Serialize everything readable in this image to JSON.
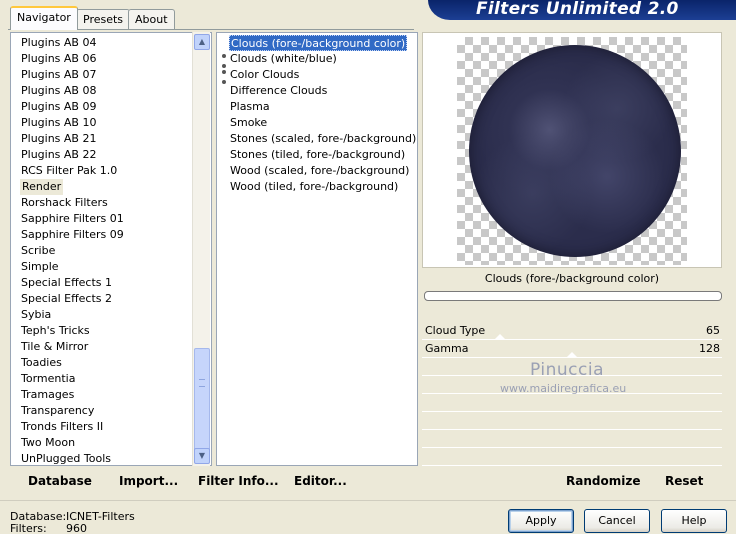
{
  "banner": {
    "title": "Filters Unlimited 2.0"
  },
  "tabs": [
    "Navigator",
    "Presets",
    "About"
  ],
  "navigator": {
    "items": [
      "Plugins AB 04",
      "Plugins AB 06",
      "Plugins AB 07",
      "Plugins AB 08",
      "Plugins AB 09",
      "Plugins AB 10",
      "Plugins AB 21",
      "Plugins AB 22",
      "RCS Filter Pak 1.0",
      "Render",
      "Rorshack Filters",
      "Sapphire Filters 01",
      "Sapphire Filters 09",
      "Scribe",
      "Simple",
      "Special Effects 1",
      "Special Effects 2",
      "Sybia",
      "Teph's Tricks",
      "Tile & Mirror",
      "Toadies",
      "Tormentia",
      "Tramages",
      "Transparency",
      "Tronds Filters II",
      "Two Moon",
      "UnPlugged Tools"
    ],
    "selected": "Render"
  },
  "filters": {
    "items": [
      "Clouds (fore-/background color)",
      "Clouds (white/blue)",
      "Color Clouds",
      "Difference Clouds",
      "Plasma",
      "Smoke",
      "Stones (scaled, fore-/background)",
      "Stones (tiled, fore-/background)",
      "Wood (scaled, fore-/background)",
      "Wood (tiled, fore-/background)"
    ],
    "selected": "Clouds (fore-/background color)"
  },
  "preview": {
    "filter_name": "Clouds (fore-/background color)"
  },
  "params": [
    {
      "label": "Cloud Type",
      "value": "65"
    },
    {
      "label": "Gamma",
      "value": "128"
    }
  ],
  "watermark": {
    "name": "Pinuccia",
    "site": "www.maidiregrafica.eu"
  },
  "toolbar": {
    "database": "Database",
    "import": "Import...",
    "filter_info": "Filter Info...",
    "editor": "Editor...",
    "randomize": "Randomize",
    "reset": "Reset"
  },
  "status": {
    "database_label": "Database:",
    "database_value": "ICNET-Filters",
    "filters_label": "Filters:",
    "filters_value": "960"
  },
  "buttons": {
    "apply": "Apply",
    "cancel": "Cancel",
    "help": "Help"
  }
}
